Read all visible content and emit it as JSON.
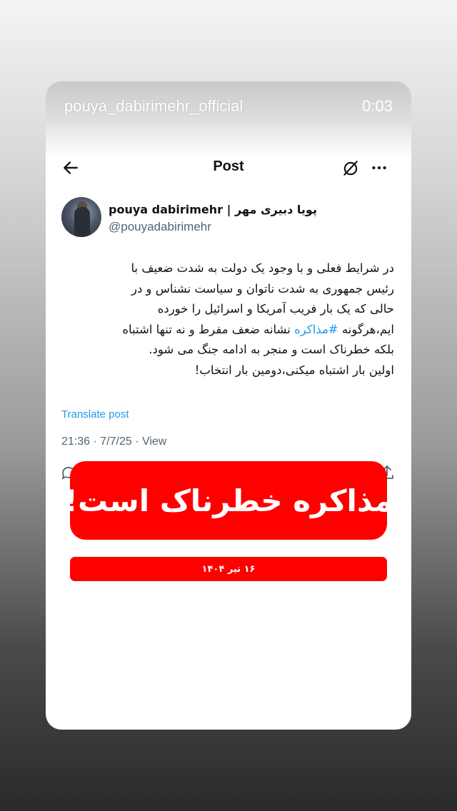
{
  "story": {
    "username": "pouya_dabirimehr_official",
    "time": "0:03"
  },
  "header": {
    "title": "Post",
    "icons": [
      "back-arrow-icon",
      "hide-icon",
      "more-icon"
    ]
  },
  "author": {
    "name": "pouya dabirimehr | پویا دبیری مهر",
    "handle": "@pouyadabirimehr"
  },
  "tweet": {
    "line1": "در شرایط فعلی و با وجود یک دولت به شدت ضعیف با",
    "line2": "رئیس جمهوری به شدت ناتوان و سیاست نشناس و در",
    "line3": "حالی که یک بار فریب آمریکا و اسرائیل را خورده",
    "line4_before": "ایم،هرگونه ",
    "hashtag": "#مذاکره",
    "line4_after": " نشانه ضعف مفرط و نه تنها اشتباه",
    "line5": "بلکه خطرناک است و منجر به ادامه جنگ می شود.",
    "line6": "اولین بار اشتباه میکنی،دومین بار انتخاب!",
    "translate_label": "Translate post",
    "meta": "21:36 · 7/7/25 · View"
  },
  "banner": {
    "text": "مذاکره خطرناک است!",
    "date": "۱۶ تیر ۱۴۰۴",
    "color": "#ff0000"
  },
  "colors": {
    "link": "#1d9bf0",
    "text": "#0f1419",
    "muted": "#536471"
  }
}
